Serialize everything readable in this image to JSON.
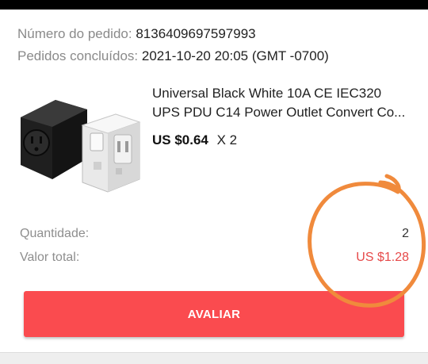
{
  "order": {
    "number_label": "Número do pedido:",
    "number_value": "8136409697597993",
    "completed_label": "Pedidos concluídos:",
    "completed_value": "2021-10-20 20:05 (GMT -0700)"
  },
  "product": {
    "title_line1": "Universal Black White 10A CE IEC320",
    "title_line2": "UPS PDU C14 Power Outlet Convert Co...",
    "price": "US $0.64",
    "quantity_multiplier": "X 2"
  },
  "summary": {
    "quantity_label": "Quantidade:",
    "quantity_value": "2",
    "total_label": "Valor total:",
    "total_value": "US $1.28"
  },
  "actions": {
    "review_label": "AVALIAR"
  },
  "colors": {
    "accent": "#fa4b4f",
    "total_price": "#e64a4a",
    "annotation_circle": "#f08a3c"
  }
}
